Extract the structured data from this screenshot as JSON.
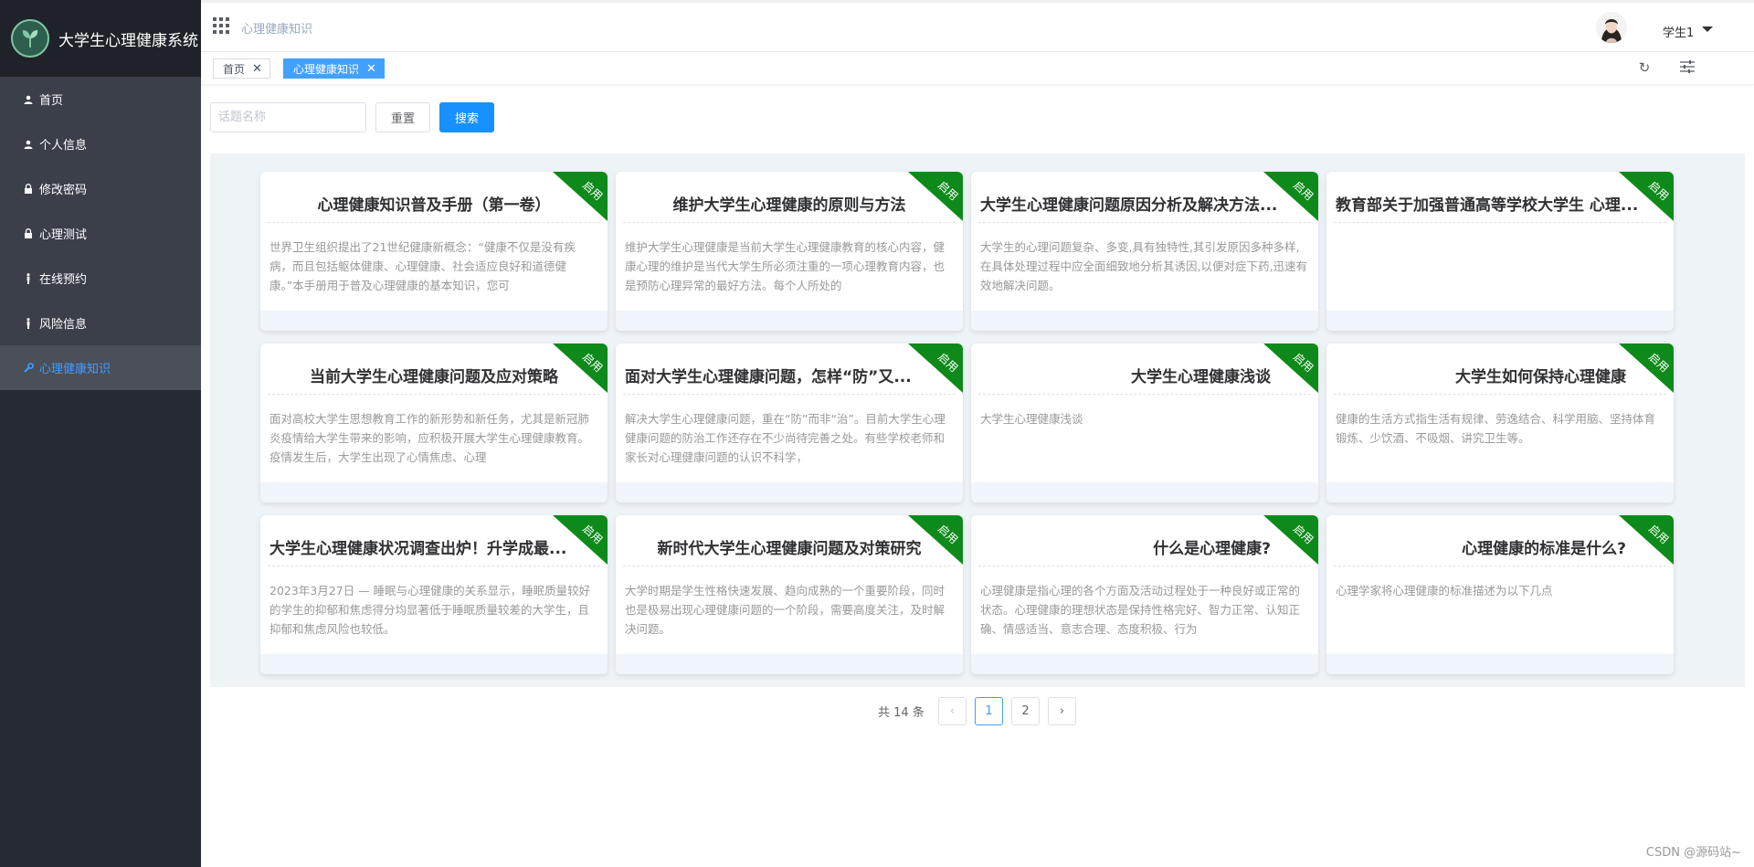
{
  "app": {
    "title": "大学生心理健康系统",
    "logo_icon": "sprout-logo-icon"
  },
  "sidebar": {
    "items": [
      {
        "label": "首页",
        "icon": "user-icon",
        "active": false
      },
      {
        "label": "个人信息",
        "icon": "user-icon",
        "active": false
      },
      {
        "label": "修改密码",
        "icon": "lock-icon",
        "active": false
      },
      {
        "label": "心理测试",
        "icon": "lock-icon",
        "active": false
      },
      {
        "label": "在线预约",
        "icon": "person-standing-icon",
        "active": false
      },
      {
        "label": "风险信息",
        "icon": "person-standing-icon",
        "active": false
      },
      {
        "label": "心理健康知识",
        "icon": "wrench-icon",
        "active": true
      }
    ]
  },
  "header": {
    "breadcrumb": "心理健康知识",
    "username": "学生1"
  },
  "tags": [
    {
      "label": "首页",
      "active": false
    },
    {
      "label": "心理健康知识",
      "active": true
    }
  ],
  "search": {
    "placeholder": "话题名称",
    "value": "",
    "reset_label": "重置",
    "search_label": "搜索"
  },
  "ribbon_label": "启用",
  "cards": [
    {
      "title": "心理健康知识普及手册（第一卷）",
      "align": "center",
      "desc": "世界卫生组织提出了21世纪健康新概念：“健康不仅是没有疾病，而且包括躯体健康、心理健康、社会适应良好和道德健康。”本手册用于普及心理健康的基本知识，您可"
    },
    {
      "title": "维护大学生心理健康的原则与方法",
      "align": "center",
      "desc": "维护大学生心理健康是当前大学生心理健康教育的核心内容，健康心理的维护是当代大学生所必须注重的一项心理教育内容，也是预防心理异常的最好方法。每个人所处的"
    },
    {
      "title": "大学生心理健康问题原因分析及解决方法...",
      "align": "left",
      "desc": "大学生的心理问题复杂、多变,具有独特性,其引发原因多种多样,在具体处理过程中应全面细致地分析其诱因,以便对症下药,迅速有效地解决问题。"
    },
    {
      "title": "教育部关于加强普通高等学校大学生 心理...",
      "align": "left",
      "desc": ""
    },
    {
      "title": "当前大学生心理健康问题及应对策略",
      "align": "center",
      "desc": "面对高校大学生思想教育工作的新形势和新任务，尤其是新冠肺炎疫情给大学生带来的影响，应积极开展大学生心理健康教育。疫情发生后，大学生出现了心情焦虑、心理"
    },
    {
      "title": "面对大学生心理健康问题，怎样“防”又...",
      "align": "left",
      "desc": "解决大学生心理健康问题，重在“防”而非“治”。目前大学生心理健康问题的防治工作还存在不少尚待完善之处。有些学校老师和家长对心理健康问题的认识不科学，"
    },
    {
      "title": "大学生心理健康浅谈",
      "align": "right",
      "desc": "大学生心理健康浅谈"
    },
    {
      "title": "大学生如何保持心理健康",
      "align": "right",
      "desc": "健康的生活方式指生活有规律、劳逸结合、科学用脑、坚持体育锻炼、少饮酒、不吸烟、讲究卫生等。"
    },
    {
      "title": "大学生心理健康状况调查出炉！升学成最...",
      "align": "left",
      "desc": "2023年3月27日 — 睡眠与心理健康的关系显示，睡眠质量较好的学生的抑郁和焦虑得分均显著低于睡眠质量较差的大学生，且抑郁和焦虑风险也较低。"
    },
    {
      "title": "新时代大学生心理健康问题及对策研究",
      "align": "center",
      "desc": "大学时期是学生性格快速发展、趋向成熟的一个重要阶段，同时也是极易出现心理健康问题的一个阶段，需要高度关注，及时解决问题。"
    },
    {
      "title": "什么是心理健康?",
      "align": "right",
      "desc": "心理健康是指心理的各个方面及活动过程处于一种良好或正常的状态。心理健康的理想状态是保持性格完好、智力正常、认知正确、情感适当、意志合理、态度积极、行为"
    },
    {
      "title": "心理健康的标准是什么?",
      "align": "right",
      "desc": "心理学家将心理健康的标准描述为以下几点"
    }
  ],
  "pagination": {
    "total_text": "共 14 条",
    "pages": [
      "1",
      "2"
    ],
    "current": "1",
    "prev": "‹",
    "next": "›"
  },
  "watermark": "CSDN @源码站~",
  "colors": {
    "sidebar_bg": "#252a33",
    "menu_bg": "#3a3f4a",
    "active_menu_text": "#409eff",
    "primary": "#1890ff",
    "ribbon": "#0e8a1a"
  }
}
